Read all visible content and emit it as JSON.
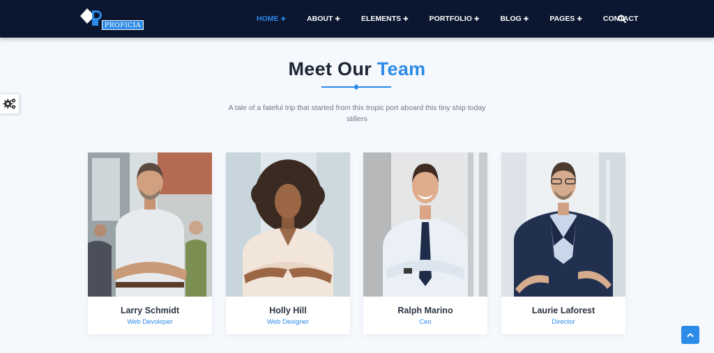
{
  "brand": {
    "logo_text": "PROFICIA",
    "accent_color": "#2c8ae8",
    "nav_bg": "#0b1730"
  },
  "nav": {
    "items": [
      {
        "label": "HOME",
        "has_submenu": true,
        "active": true
      },
      {
        "label": "ABOUT",
        "has_submenu": true,
        "active": false
      },
      {
        "label": "ELEMENTS",
        "has_submenu": true,
        "active": false
      },
      {
        "label": "PORTFOLIO",
        "has_submenu": true,
        "active": false
      },
      {
        "label": "BLOG",
        "has_submenu": true,
        "active": false
      },
      {
        "label": "PAGES",
        "has_submenu": true,
        "active": false
      },
      {
        "label": "CONTACT",
        "has_submenu": false,
        "active": false
      }
    ],
    "search_icon": "search-icon",
    "submenu_icon": "plus-icon"
  },
  "section": {
    "title_main": "Meet Our ",
    "title_accent": "Team",
    "subtitle": "A tale of a fateful trip that started from this tropic port aboard this tiny ship today stillers"
  },
  "team": [
    {
      "name": "Larry Schmidt",
      "role": "Web Devoloper"
    },
    {
      "name": "Holly Hill",
      "role": "Web Designer"
    },
    {
      "name": "Ralph Marino",
      "role": "Ceo"
    },
    {
      "name": "Laurie Laforest",
      "role": "Director"
    }
  ],
  "widgets": {
    "settings_icon": "gears-icon",
    "scroll_top_icon": "chevron-up-icon"
  }
}
